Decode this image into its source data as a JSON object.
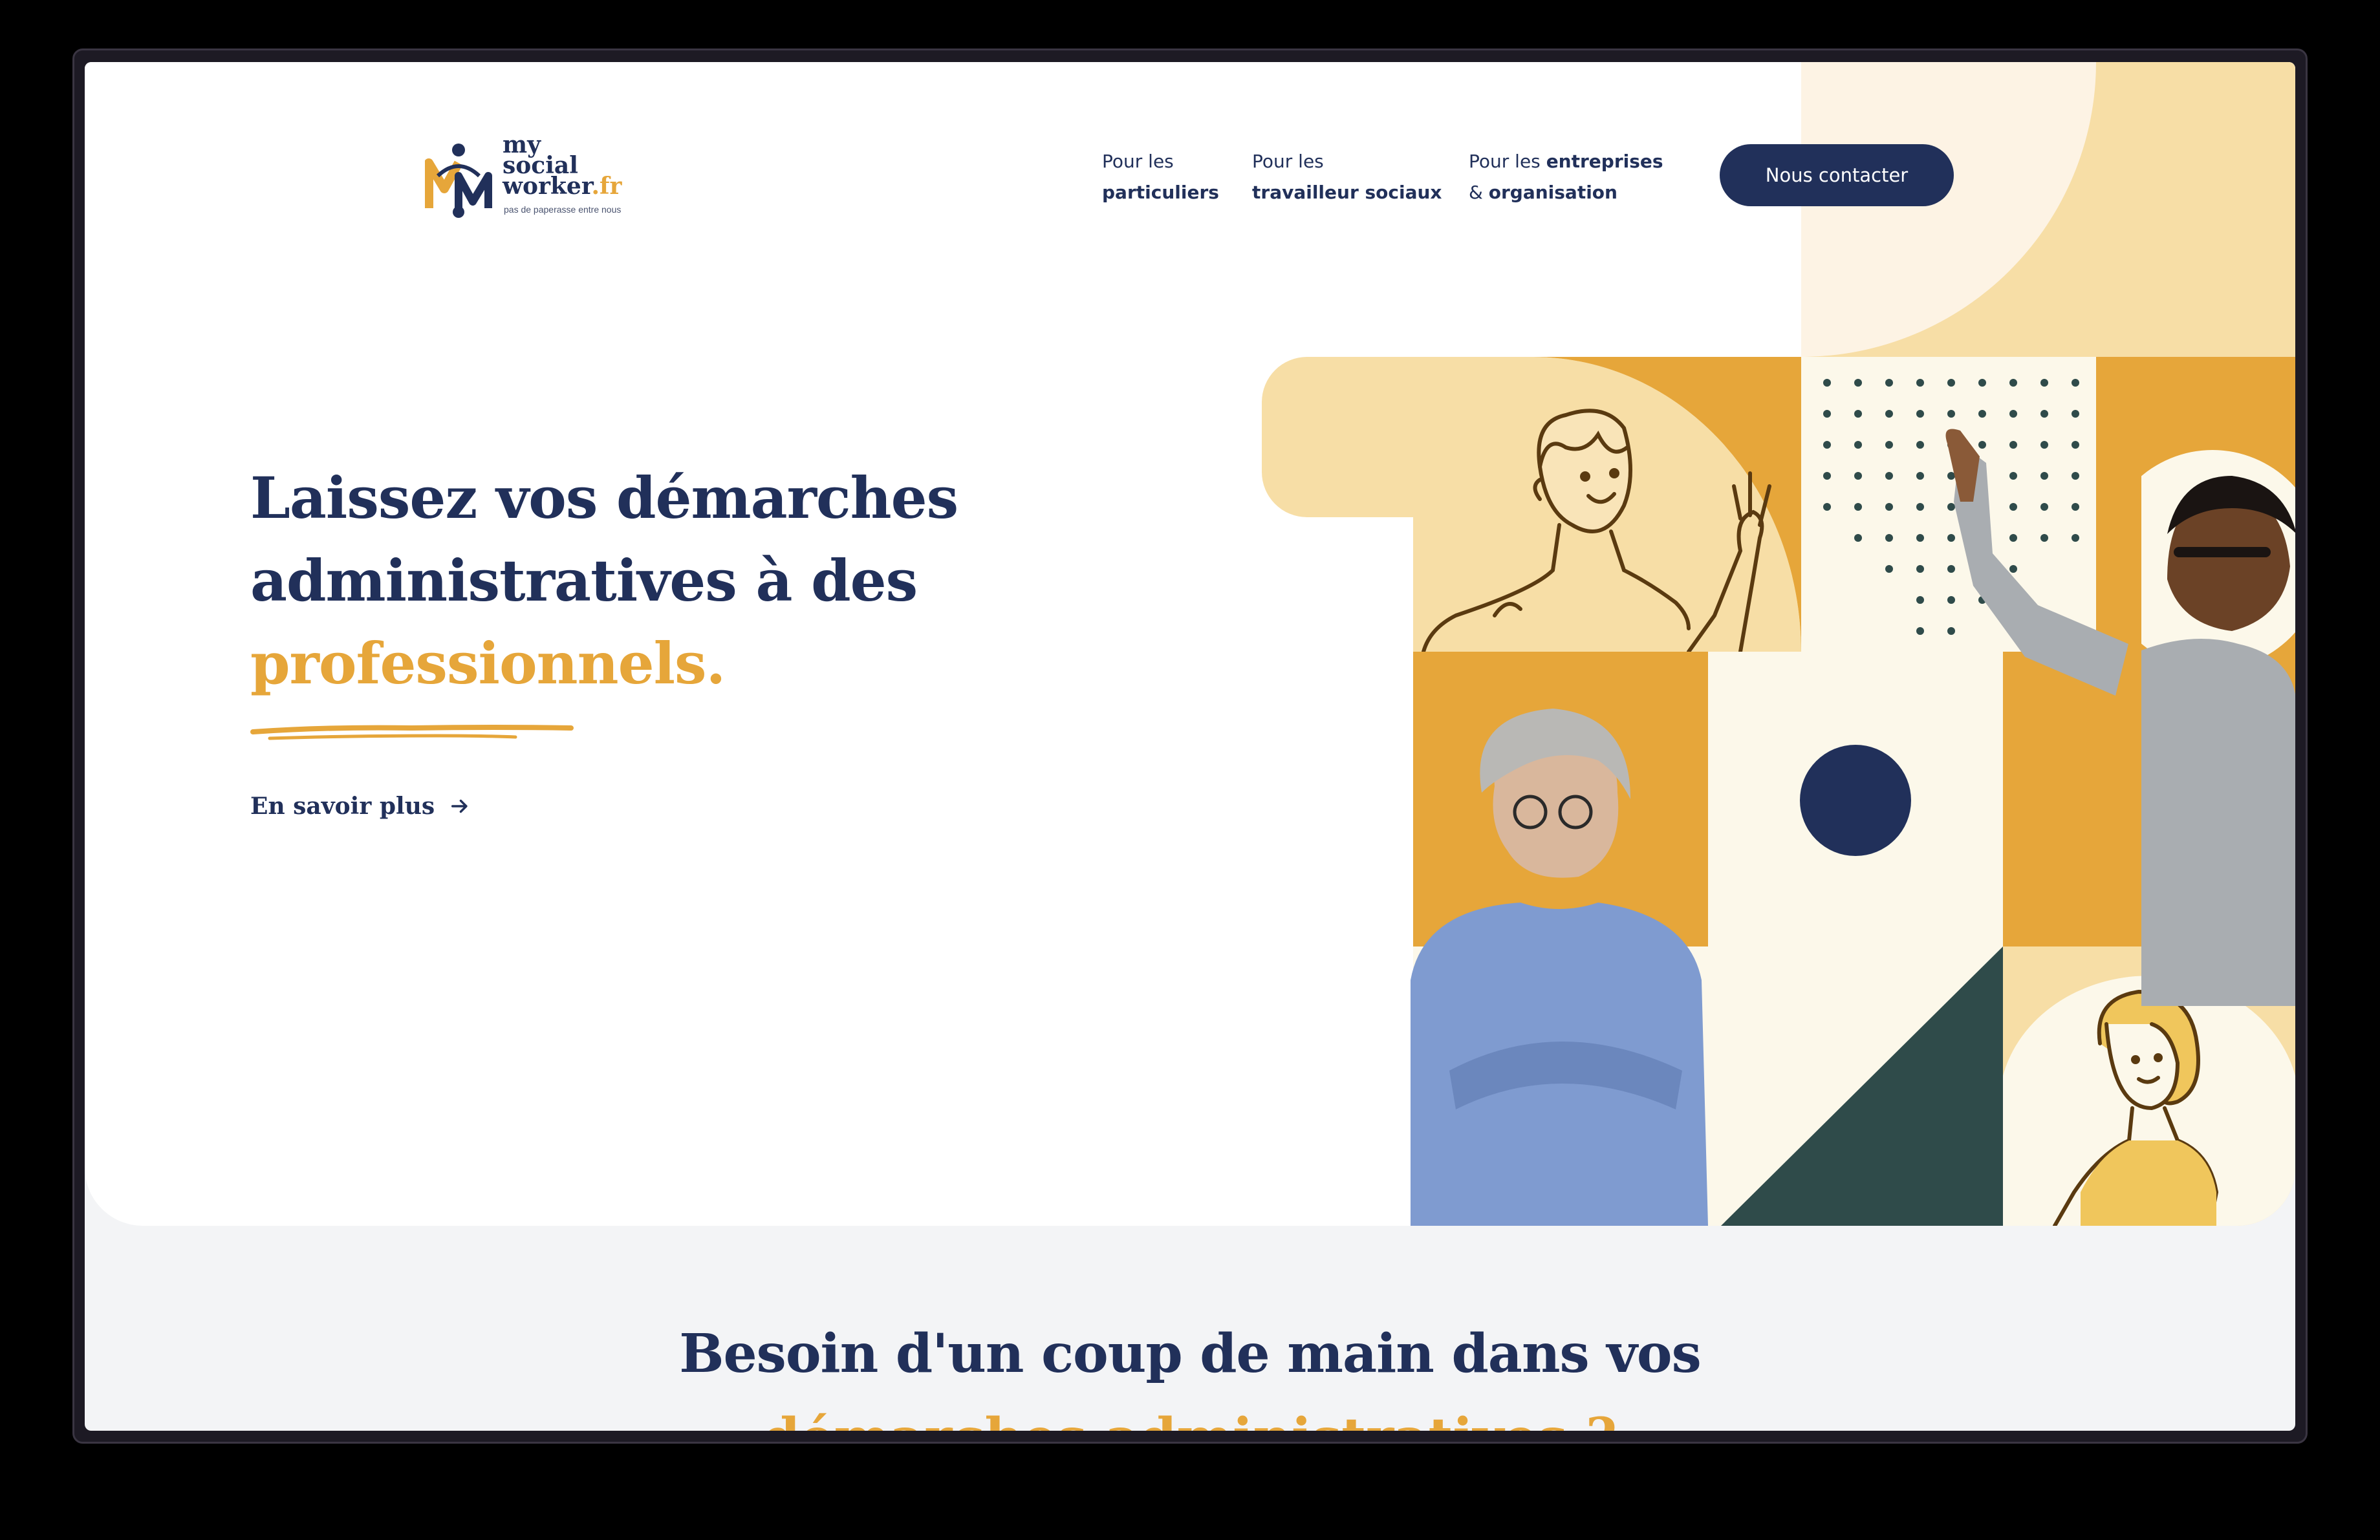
{
  "header": {
    "logo": {
      "line1": "my",
      "line2": "social",
      "line3": "worker",
      "tld": ".fr",
      "tagline": "pas de paperasse entre nous"
    },
    "nav": [
      {
        "prefix": "Pour les",
        "strong": "particuliers"
      },
      {
        "prefix": "Pour les",
        "strong": "travailleur sociaux"
      },
      {
        "prefix": "Pour les",
        "strong_1": "entreprises",
        "line2_prefix": "&",
        "line2_strong": "organisation"
      }
    ],
    "contact_label": "Nous contacter"
  },
  "hero": {
    "headline_line1": "Laissez vos démarches",
    "headline_line2": "administratives à des",
    "headline_accent": "professionnels.",
    "more_link": "En savoir plus",
    "more_icon": "arrow-right-icon"
  },
  "section2": {
    "title": "Besoin d'un coup de main dans vos",
    "subtitle": "démarches administratives ?"
  },
  "colors": {
    "navy": "#21305a",
    "mustard": "#e6a63a",
    "cream": "#f7dea6",
    "light_cream": "#fcf8ea",
    "dark_teal": "#2f4b4a",
    "background": "#f3f4f6"
  }
}
